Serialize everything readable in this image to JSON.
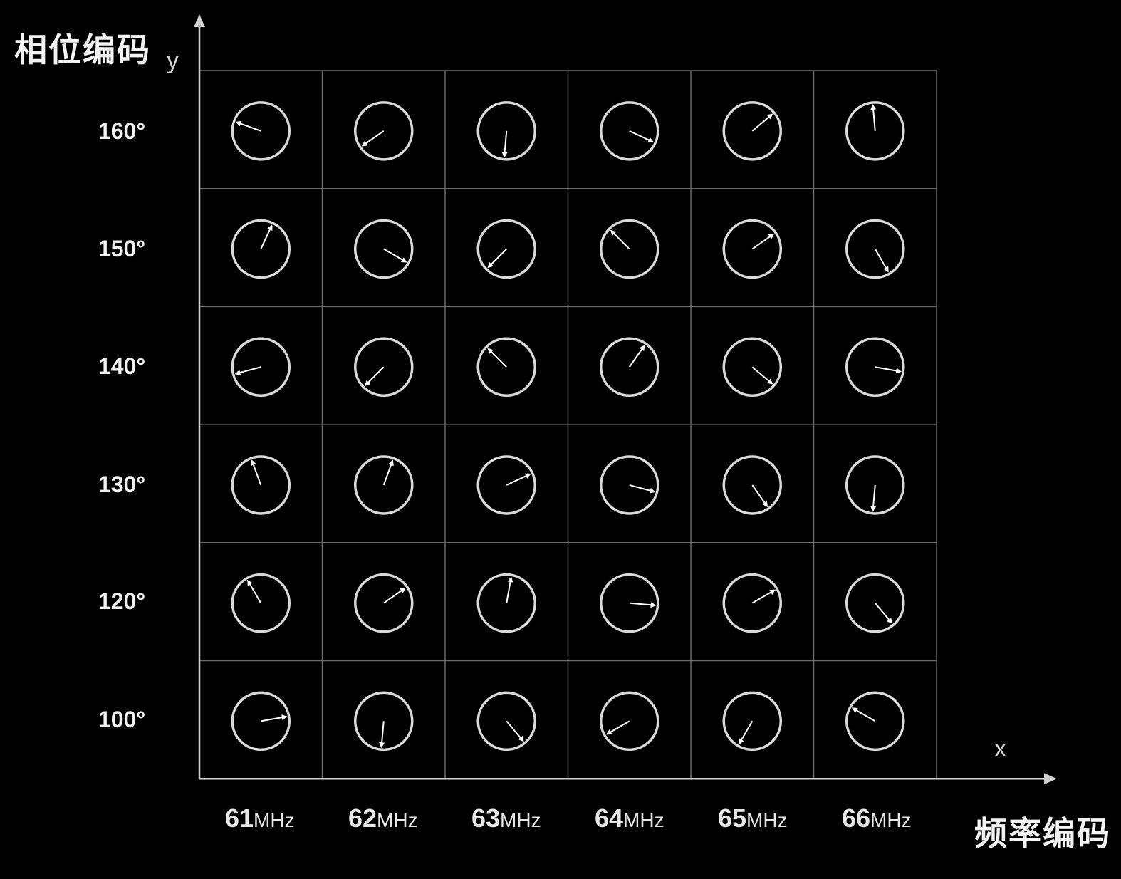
{
  "titles": {
    "y_axis_title": "相位编码",
    "x_axis_title": "频率编码",
    "y_letter": "y",
    "x_letter": "x"
  },
  "columns": [
    {
      "value": "61",
      "unit": "MHz"
    },
    {
      "value": "62",
      "unit": "MHz"
    },
    {
      "value": "63",
      "unit": "MHz"
    },
    {
      "value": "64",
      "unit": "MHz"
    },
    {
      "value": "65",
      "unit": "MHz"
    },
    {
      "value": "66",
      "unit": "MHz"
    }
  ],
  "rows": [
    {
      "label": "160°",
      "arrow_angles_deg": [
        160,
        215,
        265,
        335,
        40,
        95
      ]
    },
    {
      "label": "150°",
      "arrow_angles_deg": [
        65,
        330,
        225,
        135,
        35,
        300
      ]
    },
    {
      "label": "140°",
      "arrow_angles_deg": [
        195,
        225,
        135,
        55,
        320,
        350
      ]
    },
    {
      "label": "130°",
      "arrow_angles_deg": [
        110,
        70,
        25,
        345,
        305,
        265
      ]
    },
    {
      "label": "120°",
      "arrow_angles_deg": [
        120,
        35,
        80,
        355,
        30,
        310
      ]
    },
    {
      "label": "100°",
      "arrow_angles_deg": [
        10,
        265,
        310,
        210,
        240,
        150
      ]
    }
  ],
  "colors": {
    "background": "#000000",
    "grid": "#6a6a6a",
    "circle": "#d9d9d9",
    "arrow": "#ffffff",
    "axis": "#cfcfcf"
  }
}
